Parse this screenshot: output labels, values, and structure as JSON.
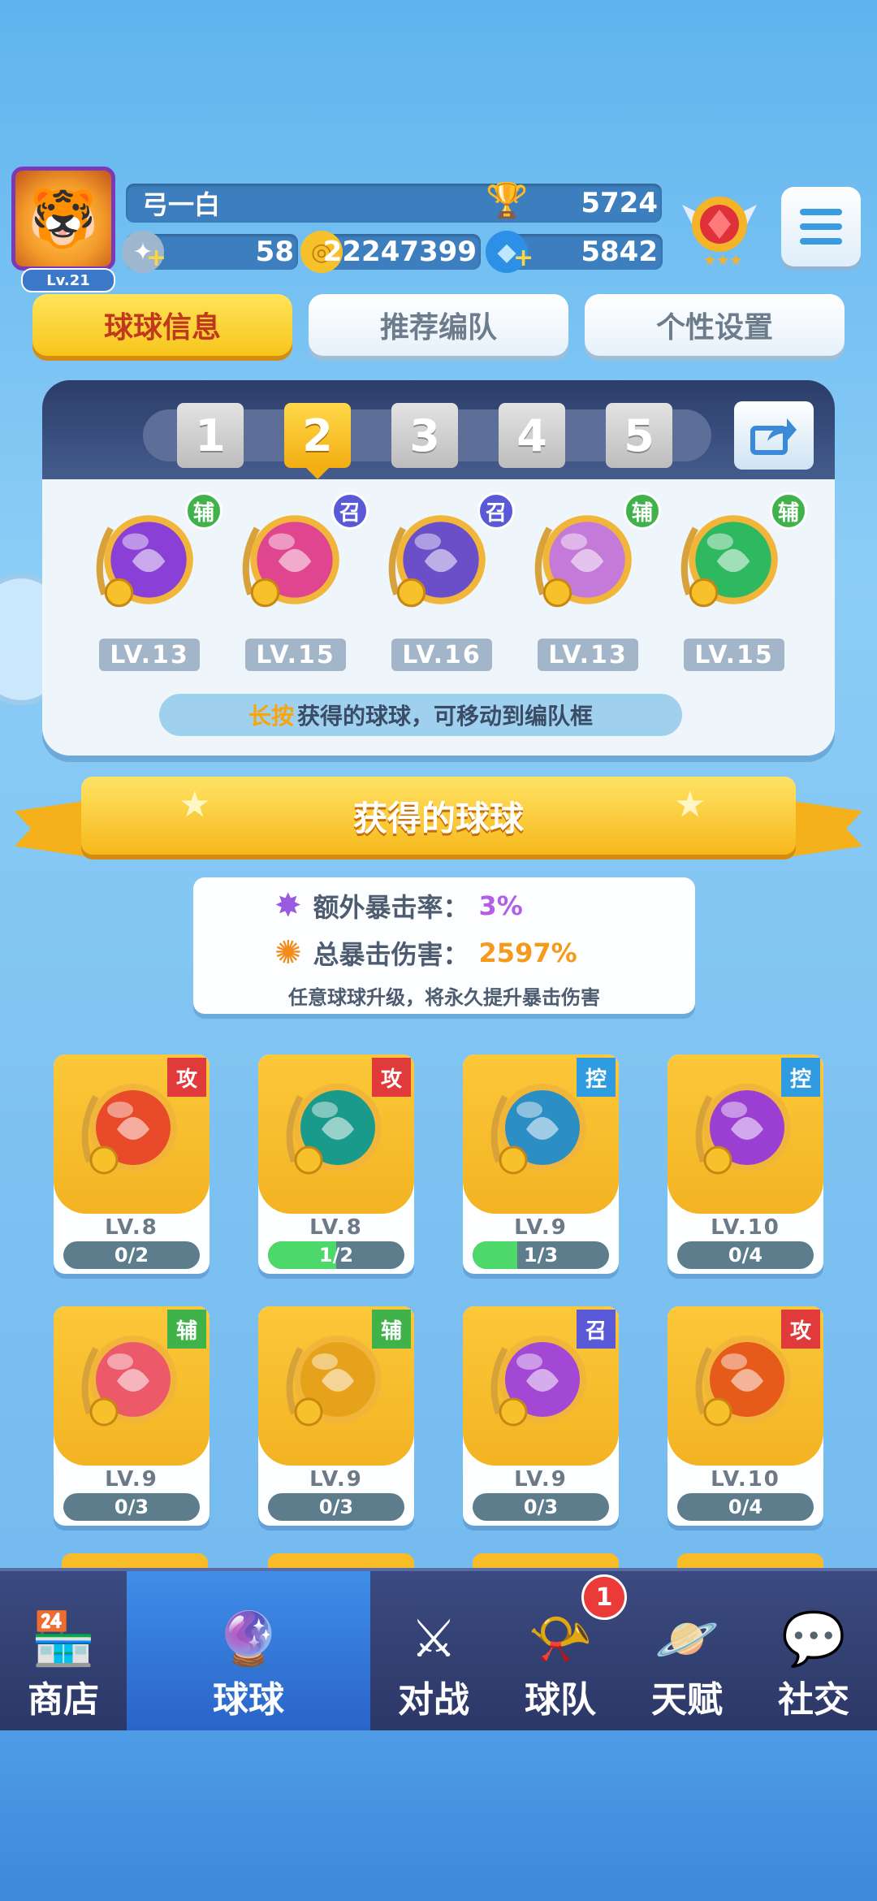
{
  "header": {
    "player_name": "弓一白",
    "player_level": "Lv.21",
    "trophies": "5724",
    "energy": "58",
    "coins": "22247399",
    "gems": "5842"
  },
  "tabs": [
    {
      "label": "球球信息",
      "active": true
    },
    {
      "label": "推荐编队",
      "active": false
    },
    {
      "label": "个性设置",
      "active": false
    }
  ],
  "team": {
    "slots": [
      "1",
      "2",
      "3",
      "4",
      "5"
    ],
    "active_slot": "2",
    "members": [
      {
        "tag": "辅",
        "level": "LV.13",
        "color": "#8a3fd6",
        "icon": "leaf-icon"
      },
      {
        "tag": "召",
        "level": "LV.15",
        "color": "#e0458f",
        "icon": "sword-icon"
      },
      {
        "tag": "召",
        "level": "LV.16",
        "color": "#6b4fc8",
        "icon": "demon-icon"
      },
      {
        "tag": "辅",
        "level": "LV.13",
        "color": "#c47ad8",
        "icon": "people-icon"
      },
      {
        "tag": "辅",
        "level": "LV.15",
        "color": "#2eb860",
        "icon": "arrow-up-icon"
      }
    ],
    "hint_key": "长按",
    "hint_rest": "获得的球球，可移动到编队框"
  },
  "section_title": "获得的球球",
  "crit": {
    "extra_label": "额外暴击率：",
    "extra_value": "3%",
    "total_label": "总暴击伤害：",
    "total_value": "2597%",
    "note": "任意球球升级，将永久提升暴击伤害"
  },
  "balls": [
    {
      "tag": "攻",
      "level": "LV.8",
      "progress": "0/2",
      "fill": 0.0,
      "color": "#e84a2a",
      "icon": "phoenix-icon"
    },
    {
      "tag": "攻",
      "level": "LV.8",
      "progress": "1/2",
      "fill": 0.5,
      "color": "#1a9a8a",
      "icon": "crossbow-icon"
    },
    {
      "tag": "控",
      "level": "LV.9",
      "progress": "1/3",
      "fill": 0.33,
      "color": "#2c8fc4",
      "icon": "wind-icon"
    },
    {
      "tag": "控",
      "level": "LV.10",
      "progress": "0/4",
      "fill": 0.0,
      "color": "#9a3fd2",
      "icon": "lock-icon"
    },
    {
      "tag": "辅",
      "level": "LV.9",
      "progress": "0/3",
      "fill": 0.0,
      "color": "#ec5a6a",
      "icon": "gift-icon"
    },
    {
      "tag": "辅",
      "level": "LV.9",
      "progress": "0/3",
      "fill": 0.0,
      "color": "#e6a21a",
      "icon": "piggy-bank-icon"
    },
    {
      "tag": "召",
      "level": "LV.9",
      "progress": "0/3",
      "fill": 0.0,
      "color": "#a348d4",
      "icon": "bird-icon"
    },
    {
      "tag": "攻",
      "level": "LV.10",
      "progress": "0/4",
      "fill": 0.0,
      "color": "#e65a1a",
      "icon": "scroll-icon"
    }
  ],
  "tag_colors": {
    "攻": "#e03a3a",
    "控": "#2f9be0",
    "辅": "#3fb24a",
    "召": "#5a5ad8"
  },
  "nav": [
    {
      "label": "商店",
      "icon": "shop-icon",
      "active": false
    },
    {
      "label": "球球",
      "icon": "ball-bag-icon",
      "active": true
    },
    {
      "label": "对战",
      "icon": "crossed-swords-icon",
      "active": false
    },
    {
      "label": "球队",
      "icon": "whistle-icon",
      "active": false,
      "badge": "1"
    },
    {
      "label": "天赋",
      "icon": "planet-icon",
      "active": false
    },
    {
      "label": "社交",
      "icon": "chat-heart-icon",
      "active": false
    }
  ]
}
